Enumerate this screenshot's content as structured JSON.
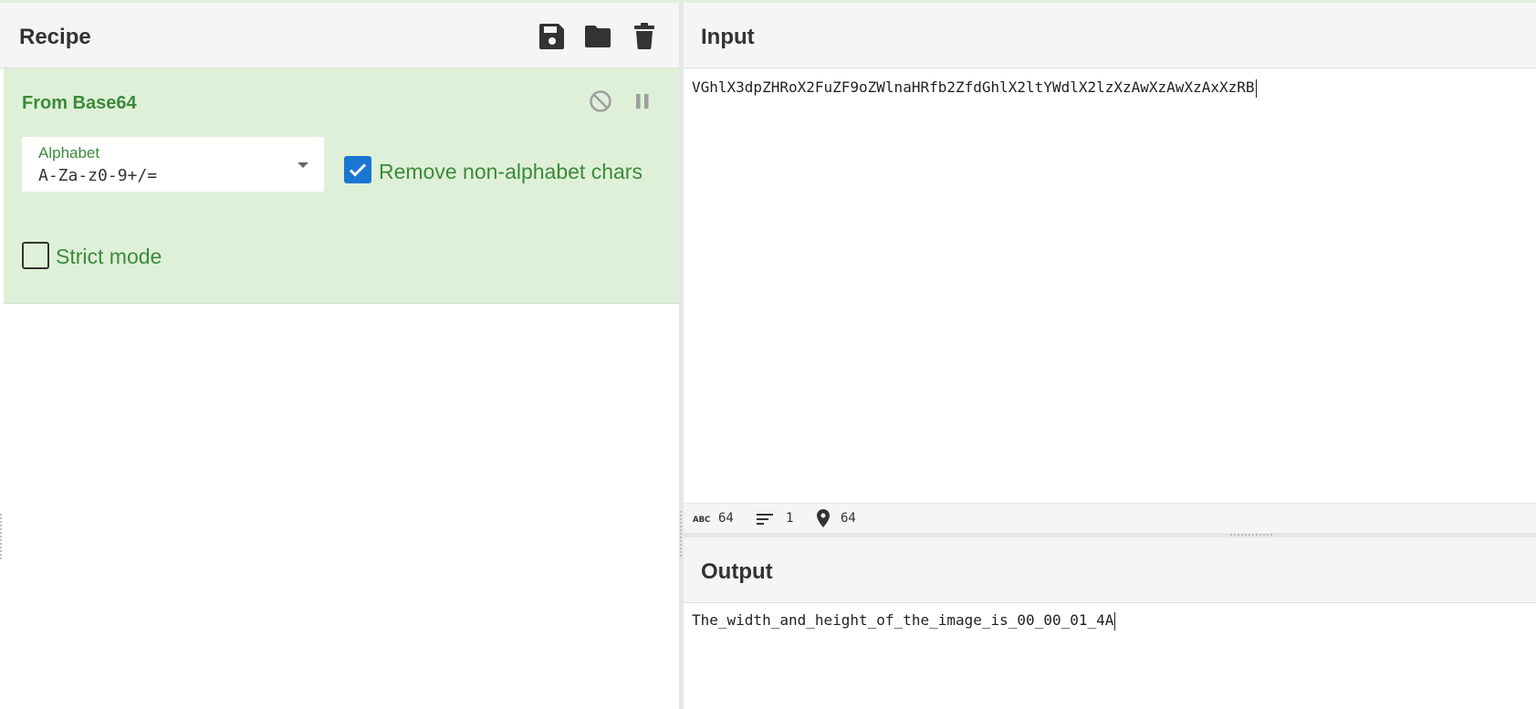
{
  "recipe": {
    "title": "Recipe",
    "icons": [
      "save-icon",
      "folder-icon",
      "trash-icon"
    ]
  },
  "operation": {
    "name": "From Base64",
    "alphabet_label": "Alphabet",
    "alphabet_value": "A-Za-z0-9+/=",
    "remove_non_alphabet_label": "Remove non-alphabet chars",
    "remove_non_alphabet_checked": true,
    "strict_mode_label": "Strict mode",
    "strict_mode_checked": false
  },
  "input": {
    "title": "Input",
    "text": "VGhlX3dpZHRoX2FuZF9oZWlnaHRfb2ZfdGhlX2ltYWdlX2lzXzAwXzAwXzAxXzRB"
  },
  "status": {
    "chars": "64",
    "lines": "1",
    "position": "64"
  },
  "output": {
    "title": "Output",
    "text": "The_width_and_height_of_the_image_is_00_00_01_4A"
  },
  "colors": {
    "accent_green": "#3b8a3b",
    "operation_bg": "#dff0d8",
    "checkbox_blue": "#1976d2"
  }
}
